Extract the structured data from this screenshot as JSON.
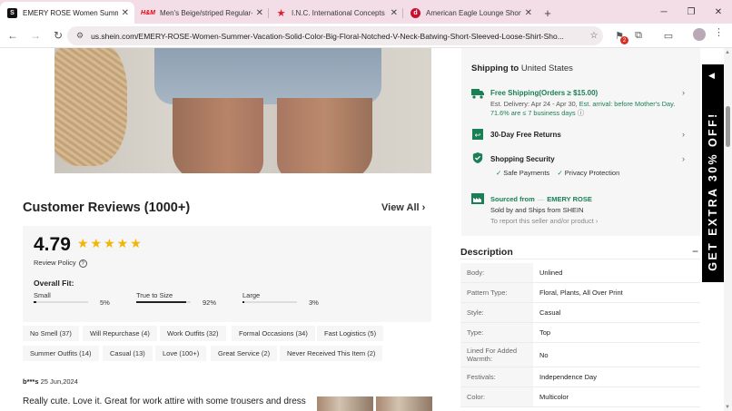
{
  "browser": {
    "tabs": [
      {
        "title": "EMERY ROSE Women Summer Vacation",
        "favicon": "S",
        "favicon_color": "#111111",
        "active": true
      },
      {
        "title": "Men's Beige/striped Regular-Fit",
        "favicon": "H&M",
        "favicon_color": "#e50010",
        "active": false
      },
      {
        "title": "I.N.C. International Concepts Women",
        "favicon": "★",
        "favicon_color": "#e21a2c",
        "active": false
      },
      {
        "title": "American Eagle Lounge Short Sleeve",
        "favicon": "d",
        "favicon_color": "#c8102e",
        "active": false
      }
    ],
    "new_tab": "+",
    "url": "us.shein.com/EMERY-ROSE-Women-Summer-Vacation-Solid-Color-Big-Floral-Notched-V-Neck-Batwing-Short-Sleeved-Loose-Shirt-Sho...",
    "extension_badge": "2"
  },
  "reviews": {
    "title": "Customer Reviews (1000+)",
    "view_all": "View All",
    "score": "4.79",
    "stars": "★★★★★",
    "policy": "Review Policy",
    "overall_fit": "Overall Fit:",
    "fit": [
      {
        "label": "Small",
        "pct": "5%",
        "value": 0.05
      },
      {
        "label": "True to Size",
        "pct": "92%",
        "value": 0.92
      },
      {
        "label": "Large",
        "pct": "3%",
        "value": 0.03
      }
    ],
    "tags": [
      "No Smell (37)",
      "Will Repurchase (4)",
      "Work Outfits (32)",
      "Formal Occasions (34)",
      "Fast Logistics (5)",
      "Summer Outfits (14)",
      "Casual (13)",
      "Love (100+)",
      "Great Service (2)",
      "Never Received This Item (2)"
    ],
    "first_review": {
      "user": "b***s",
      "date": "25 Jun,2024",
      "text": "Really cute. Love it. Great for work attire with some trousers and dress"
    }
  },
  "shipping": {
    "heading": "Shipping to",
    "country": "United States",
    "free_title": "Free Shipping(Orders ≥ $15.00)",
    "est_prefix": "Est. Delivery: Apr 24 - Apr 30,",
    "est_green": "Est. arrival: before Mother's Day.",
    "est_line2": "71.6% are ≤ 7 business days",
    "returns": "30-Day Free Returns",
    "security": "Shopping Security",
    "safe_payments": "Safe Payments",
    "privacy": "Privacy Protection",
    "sourced_from": "Sourced from",
    "sourced_country": "—",
    "brand": "EMERY ROSE",
    "sold_by": "Sold by and Ships from SHEIN",
    "report": "To report this seller and/or product"
  },
  "description": {
    "title": "Description",
    "toggle": "−",
    "rows": [
      {
        "k": "Body:",
        "v": "Unlined"
      },
      {
        "k": "Pattern Type:",
        "v": "Floral, Plants, All Over Print"
      },
      {
        "k": "Style:",
        "v": "Casual"
      },
      {
        "k": "Type:",
        "v": "Top"
      },
      {
        "k": "Lined For Added Warmth:",
        "v": "No"
      },
      {
        "k": "Festivals:",
        "v": "Independence Day"
      },
      {
        "k": "Color:",
        "v": "Multicolor"
      }
    ]
  },
  "promo": {
    "text": "GET EXTRA 30% OFF!"
  }
}
